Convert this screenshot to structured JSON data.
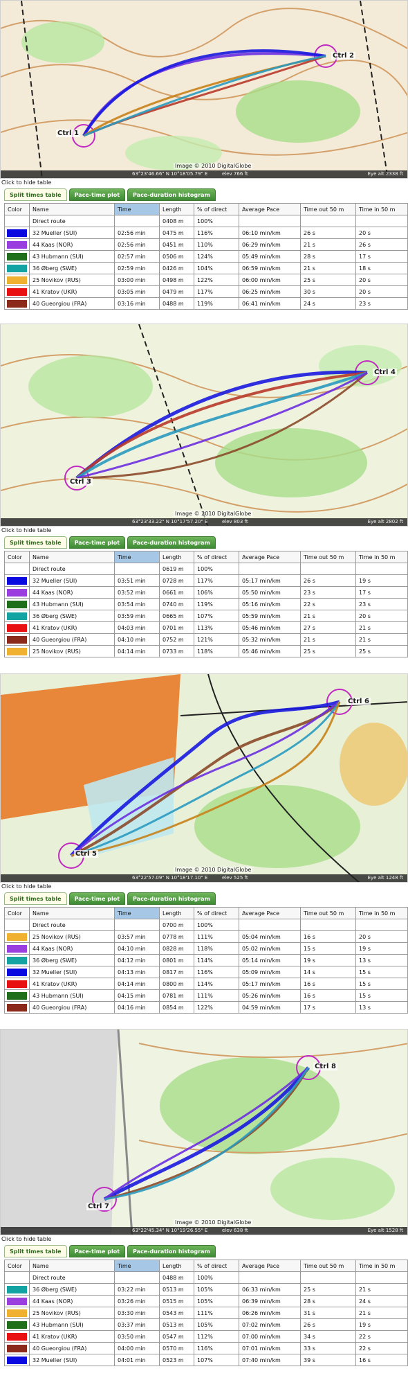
{
  "hide_table_label": "Click to hide table",
  "tabs": [
    "Split times table",
    "Pace-time plot",
    "Pace-duration histogram"
  ],
  "columns": [
    "Color",
    "Name",
    "Time",
    "Length",
    "% of direct",
    "Average Pace",
    "Time out 50 m",
    "Time in 50 m"
  ],
  "icons": {
    "control_marker": "control-circle-icon",
    "route_line": "route-line"
  },
  "legs": [
    {
      "map": {
        "controls": [
          "Ctrl 1",
          "Ctrl 2"
        ],
        "copyright": "Image © 2010 DigitalGlobe",
        "coords": "63°23'46.66\" N    10°18'05.79\" E",
        "elev": "elev  766 ft",
        "eye": "Eye alt  2338 ft",
        "route_colors": [
          "#6b2fe0",
          "#1a1adf",
          "#c8821a",
          "#b83a2a",
          "#2a9ac0"
        ]
      },
      "rows": [
        {
          "color": "",
          "name": "Direct route",
          "time": "",
          "length": "0408 m",
          "pct": "100%",
          "pace": "",
          "out": "",
          "in": ""
        },
        {
          "color": "#0a0ae0",
          "name": "32 Mueller (SUI)",
          "time": "02:56 min",
          "length": "0475 m",
          "pct": "116%",
          "pace": "06:10 min/km",
          "out": "26 s",
          "in": "20 s"
        },
        {
          "color": "#9b3ee0",
          "name": "44 Kaas (NOR)",
          "time": "02:56 min",
          "length": "0451 m",
          "pct": "110%",
          "pace": "06:29 min/km",
          "out": "21 s",
          "in": "26 s"
        },
        {
          "color": "#1f6f1a",
          "name": "43 Hubmann (SUI)",
          "time": "02:57 min",
          "length": "0506 m",
          "pct": "124%",
          "pace": "05:49 min/km",
          "out": "28 s",
          "in": "17 s"
        },
        {
          "color": "#14a3a3",
          "name": "36 Øberg (SWE)",
          "time": "02:59 min",
          "length": "0426 m",
          "pct": "104%",
          "pace": "06:59 min/km",
          "out": "21 s",
          "in": "18 s"
        },
        {
          "color": "#f0b030",
          "name": "25 Novikov (RUS)",
          "time": "03:00 min",
          "length": "0498 m",
          "pct": "122%",
          "pace": "06:00 min/km",
          "out": "25 s",
          "in": "20 s"
        },
        {
          "color": "#e81010",
          "name": "41 Kratov (UKR)",
          "time": "03:05 min",
          "length": "0479 m",
          "pct": "117%",
          "pace": "06:25 min/km",
          "out": "30 s",
          "in": "20 s"
        },
        {
          "color": "#8b2a1a",
          "name": "40 Gueorgiou (FRA)",
          "time": "03:16 min",
          "length": "0488 m",
          "pct": "119%",
          "pace": "06:41 min/km",
          "out": "24 s",
          "in": "23 s"
        }
      ]
    },
    {
      "map": {
        "controls": [
          "Ctrl 3",
          "Ctrl 4"
        ],
        "copyright": "Image © 2010 DigitalGlobe",
        "coords": "63°23'33.22\" N    10°17'57.20\" E",
        "elev": "elev  803 ft",
        "eye": "Eye alt  2802 ft",
        "route_colors": [
          "#1a1adf",
          "#b83a2a",
          "#2a9ac0",
          "#8b4a2a",
          "#6b2fe0"
        ]
      },
      "rows": [
        {
          "color": "",
          "name": "Direct route",
          "time": "",
          "length": "0619 m",
          "pct": "100%",
          "pace": "",
          "out": "",
          "in": ""
        },
        {
          "color": "#0a0ae0",
          "name": "32 Mueller (SUI)",
          "time": "03:51 min",
          "length": "0728 m",
          "pct": "117%",
          "pace": "05:17 min/km",
          "out": "26 s",
          "in": "19 s"
        },
        {
          "color": "#9b3ee0",
          "name": "44 Kaas (NOR)",
          "time": "03:52 min",
          "length": "0661 m",
          "pct": "106%",
          "pace": "05:50 min/km",
          "out": "23 s",
          "in": "17 s"
        },
        {
          "color": "#1f6f1a",
          "name": "43 Hubmann (SUI)",
          "time": "03:54 min",
          "length": "0740 m",
          "pct": "119%",
          "pace": "05:16 min/km",
          "out": "22 s",
          "in": "23 s"
        },
        {
          "color": "#14a3a3",
          "name": "36 Øberg (SWE)",
          "time": "03:59 min",
          "length": "0665 m",
          "pct": "107%",
          "pace": "05:59 min/km",
          "out": "21 s",
          "in": "20 s"
        },
        {
          "color": "#e81010",
          "name": "41 Kratov (UKR)",
          "time": "04:03 min",
          "length": "0701 m",
          "pct": "113%",
          "pace": "05:46 min/km",
          "out": "27 s",
          "in": "21 s"
        },
        {
          "color": "#8b2a1a",
          "name": "40 Gueorgiou (FRA)",
          "time": "04:10 min",
          "length": "0752 m",
          "pct": "121%",
          "pace": "05:32 min/km",
          "out": "21 s",
          "in": "21 s"
        },
        {
          "color": "#f0b030",
          "name": "25 Novikov (RUS)",
          "time": "04:14 min",
          "length": "0733 m",
          "pct": "118%",
          "pace": "05:46 min/km",
          "out": "25 s",
          "in": "25 s"
        }
      ]
    },
    {
      "map": {
        "controls": [
          "Ctrl 5",
          "Ctrl 6"
        ],
        "copyright": "Image © 2010 DigitalGlobe",
        "coords": "63°22'57.09\" N    10°18'17.10\" E",
        "elev": "elev  525 ft",
        "eye": "Eye alt  1248 ft",
        "route_colors": [
          "#1a1adf",
          "#8b4a2a",
          "#6b2fe0",
          "#2a9ac0",
          "#c8821a"
        ]
      },
      "rows": [
        {
          "color": "",
          "name": "Direct route",
          "time": "",
          "length": "0700 m",
          "pct": "100%",
          "pace": "",
          "out": "",
          "in": ""
        },
        {
          "color": "#f0b030",
          "name": "25 Novikov (RUS)",
          "time": "03:57 min",
          "length": "0778 m",
          "pct": "111%",
          "pace": "05:04 min/km",
          "out": "16 s",
          "in": "20 s"
        },
        {
          "color": "#9b3ee0",
          "name": "44 Kaas (NOR)",
          "time": "04:10 min",
          "length": "0828 m",
          "pct": "118%",
          "pace": "05:02 min/km",
          "out": "15 s",
          "in": "19 s"
        },
        {
          "color": "#14a3a3",
          "name": "36 Øberg (SWE)",
          "time": "04:12 min",
          "length": "0801 m",
          "pct": "114%",
          "pace": "05:14 min/km",
          "out": "19 s",
          "in": "13 s"
        },
        {
          "color": "#0a0ae0",
          "name": "32 Mueller (SUI)",
          "time": "04:13 min",
          "length": "0817 m",
          "pct": "116%",
          "pace": "05:09 min/km",
          "out": "14 s",
          "in": "15 s"
        },
        {
          "color": "#e81010",
          "name": "41 Kratov (UKR)",
          "time": "04:14 min",
          "length": "0800 m",
          "pct": "114%",
          "pace": "05:17 min/km",
          "out": "16 s",
          "in": "15 s"
        },
        {
          "color": "#1f6f1a",
          "name": "43 Hubmann (SUI)",
          "time": "04:15 min",
          "length": "0781 m",
          "pct": "111%",
          "pace": "05:26 min/km",
          "out": "16 s",
          "in": "15 s"
        },
        {
          "color": "#8b2a1a",
          "name": "40 Gueorgiou (FRA)",
          "time": "04:16 min",
          "length": "0854 m",
          "pct": "122%",
          "pace": "04:59 min/km",
          "out": "17 s",
          "in": "13 s"
        }
      ]
    },
    {
      "map": {
        "controls": [
          "Ctrl 7",
          "Ctrl 8"
        ],
        "copyright": "Image © 2010 DigitalGlobe",
        "coords": "63°22'45.34\" N    10°19'26.55\" E",
        "elev": "elev  638 ft",
        "eye": "Eye alt  1528 ft",
        "route_colors": [
          "#1a1adf",
          "#8b4a2a",
          "#6b2fe0",
          "#2a9ac0"
        ]
      },
      "rows": [
        {
          "color": "",
          "name": "Direct route",
          "time": "",
          "length": "0488 m",
          "pct": "100%",
          "pace": "",
          "out": "",
          "in": ""
        },
        {
          "color": "#14a3a3",
          "name": "36 Øberg (SWE)",
          "time": "03:22 min",
          "length": "0513 m",
          "pct": "105%",
          "pace": "06:33 min/km",
          "out": "25 s",
          "in": "21 s"
        },
        {
          "color": "#9b3ee0",
          "name": "44 Kaas (NOR)",
          "time": "03:26 min",
          "length": "0515 m",
          "pct": "105%",
          "pace": "06:39 min/km",
          "out": "28 s",
          "in": "24 s"
        },
        {
          "color": "#f0b030",
          "name": "25 Novikov (RUS)",
          "time": "03:30 min",
          "length": "0543 m",
          "pct": "111%",
          "pace": "06:26 min/km",
          "out": "31 s",
          "in": "21 s"
        },
        {
          "color": "#1f6f1a",
          "name": "43 Hubmann (SUI)",
          "time": "03:37 min",
          "length": "0513 m",
          "pct": "105%",
          "pace": "07:02 min/km",
          "out": "26 s",
          "in": "19 s"
        },
        {
          "color": "#e81010",
          "name": "41 Kratov (UKR)",
          "time": "03:50 min",
          "length": "0547 m",
          "pct": "112%",
          "pace": "07:00 min/km",
          "out": "34 s",
          "in": "22 s"
        },
        {
          "color": "#8b2a1a",
          "name": "40 Gueorgiou (FRA)",
          "time": "04:00 min",
          "length": "0570 m",
          "pct": "116%",
          "pace": "07:01 min/km",
          "out": "33 s",
          "in": "22 s"
        },
        {
          "color": "#0a0ae0",
          "name": "32 Mueller (SUI)",
          "time": "04:01 min",
          "length": "0523 m",
          "pct": "107%",
          "pace": "07:40 min/km",
          "out": "39 s",
          "in": "16 s"
        }
      ]
    }
  ]
}
